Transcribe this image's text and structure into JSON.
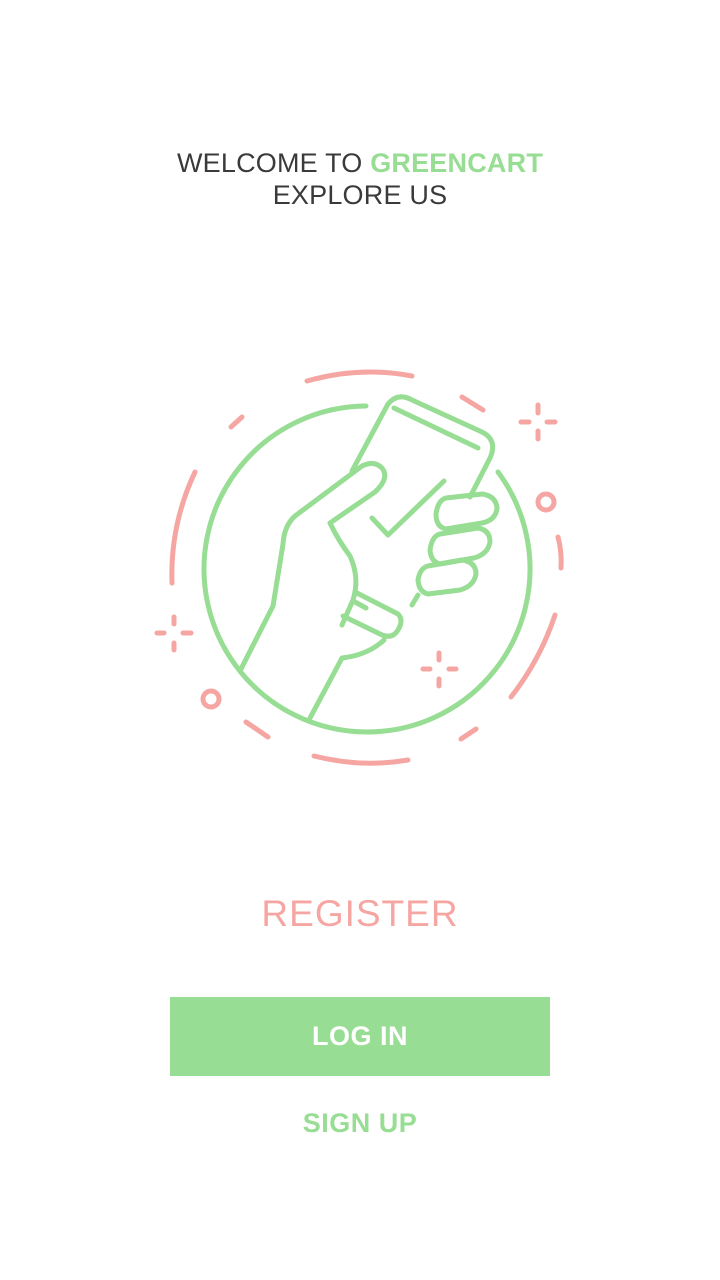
{
  "header": {
    "welcome_prefix": "WELCOME TO",
    "brand_name": "GREENCART",
    "subtitle": "EXPLORE US"
  },
  "illustration": {
    "icon": "hand-holding-phone-checkmark-icon"
  },
  "actions": {
    "register_label": "REGISTER",
    "login_label": "LOG IN",
    "signup_label": "SIGN UP"
  },
  "colors": {
    "primary_green": "#97dd93",
    "accent_pink": "#f6a6a2",
    "text_dark": "#3a3a3a",
    "background": "#ffffff"
  }
}
